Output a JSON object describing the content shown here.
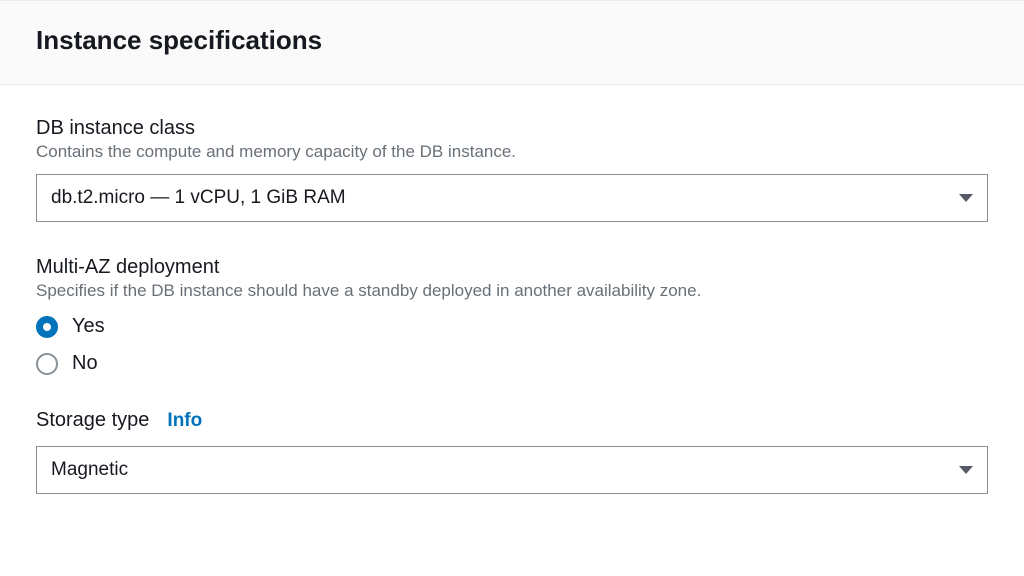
{
  "panel": {
    "title": "Instance specifications"
  },
  "db_instance_class": {
    "label": "DB instance class",
    "description": "Contains the compute and memory capacity of the DB instance.",
    "selected": "db.t2.micro — 1 vCPU, 1 GiB RAM"
  },
  "multi_az": {
    "label": "Multi-AZ deployment",
    "description": "Specifies if the DB instance should have a standby deployed in another availability zone.",
    "options": {
      "yes": "Yes",
      "no": "No"
    },
    "selected": "yes"
  },
  "storage_type": {
    "label": "Storage type",
    "info": "Info",
    "selected": "Magnetic"
  }
}
